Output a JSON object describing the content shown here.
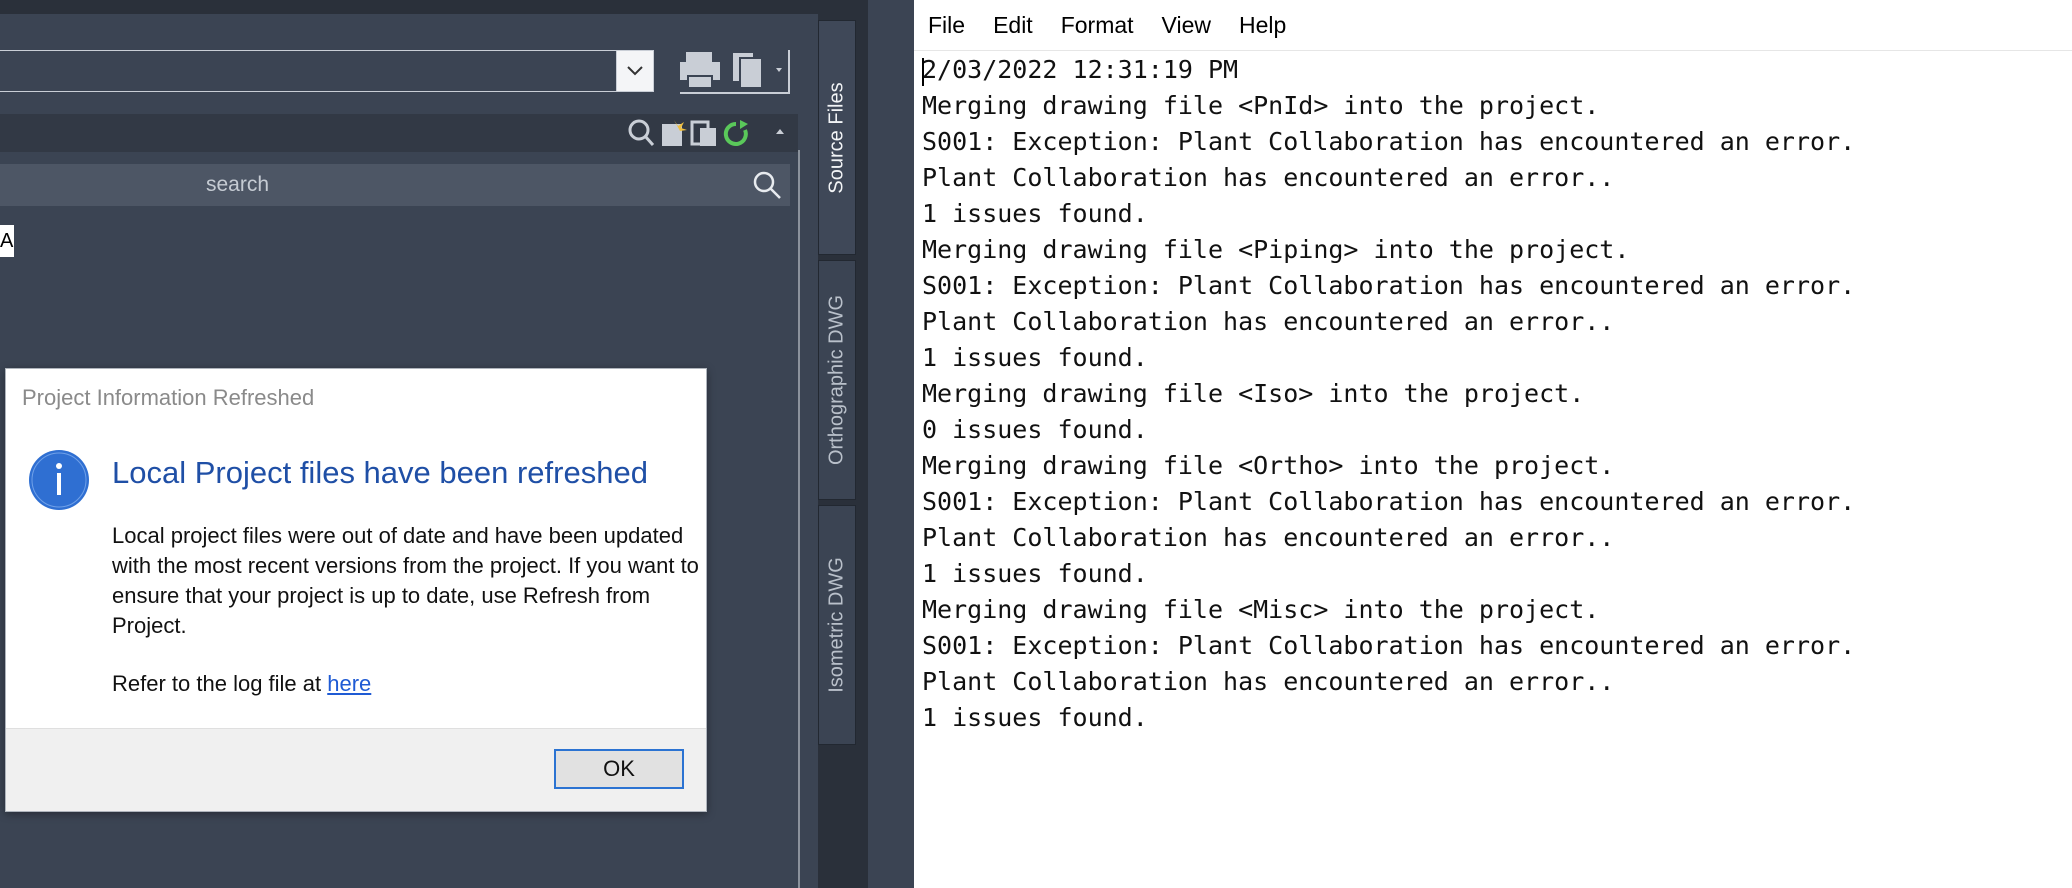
{
  "left_panel": {
    "search_placeholder": "search",
    "partial_label": "A",
    "tabs": [
      "Source Files",
      "Orthographic DWG",
      "Isometric DWG"
    ]
  },
  "dialog": {
    "title": "Project Information Refreshed",
    "heading": "Local Project files have been refreshed",
    "body": "Local project files were out of date and have been updated with the most recent versions from the project. If you want to ensure that your project is up to date, use Refresh from Project.",
    "ref_prefix": "Refer to the log file at ",
    "ref_link": "here",
    "ok_label": "OK"
  },
  "notepad": {
    "menu": [
      "File",
      "Edit",
      "Format",
      "View",
      "Help"
    ],
    "lines": [
      "2/03/2022 12:31:19 PM",
      "Merging drawing file <PnId> into the project.",
      "S001: Exception: Plant Collaboration has encountered an error.",
      "Plant Collaboration has encountered an error..",
      "1 issues found.",
      "Merging drawing file <Piping> into the project.",
      "S001: Exception: Plant Collaboration has encountered an error.",
      "Plant Collaboration has encountered an error..",
      "1 issues found.",
      "Merging drawing file <Iso> into the project.",
      "0 issues found.",
      "Merging drawing file <Ortho> into the project.",
      "S001: Exception: Plant Collaboration has encountered an error.",
      "Plant Collaboration has encountered an error..",
      "1 issues found.",
      "Merging drawing file <Misc> into the project.",
      "S001: Exception: Plant Collaboration has encountered an error.",
      "Plant Collaboration has encountered an error..",
      "1 issues found."
    ]
  }
}
